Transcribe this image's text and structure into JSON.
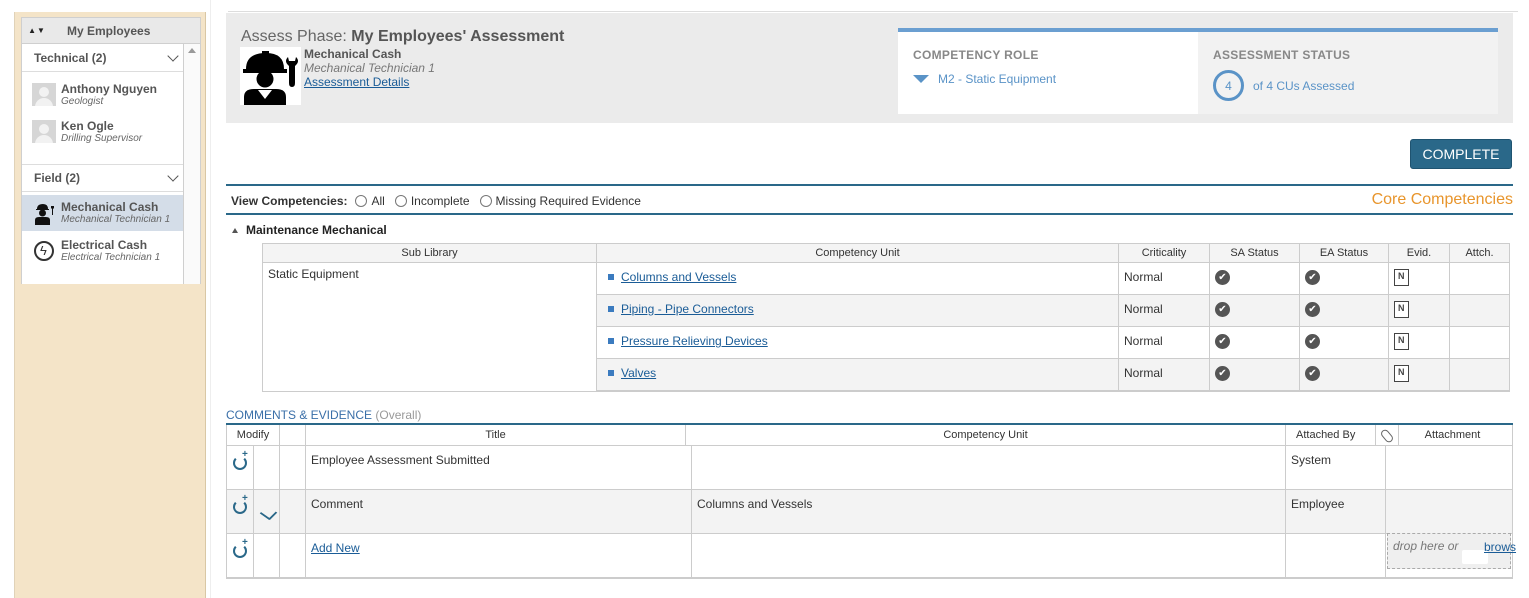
{
  "sidebar": {
    "title": "My Employees",
    "sort_glyph": "▲▼",
    "groups": [
      {
        "label": "Technical (2)",
        "employees": [
          {
            "name": "Anthony Nguyen",
            "role": "Geologist"
          },
          {
            "name": "Ken Ogle",
            "role": "Drilling Supervisor"
          }
        ]
      },
      {
        "label": "Field (2)",
        "employees": [
          {
            "name": "Mechanical Cash",
            "role": "Mechanical Technician 1",
            "selected": true
          },
          {
            "name": "Electrical Cash",
            "role": "Electrical Technician 1"
          }
        ]
      }
    ]
  },
  "header": {
    "phase_prefix": "Assess Phase:",
    "phase_title": "My Employees' Assessment",
    "employee_name": "Mechanical Cash",
    "employee_role": "Mechanical Technician 1",
    "details_link": "Assessment Details",
    "competency_role_label": "COMPETENCY ROLE",
    "competency_role_value": "M2 - Static Equipment",
    "assessment_status_label": "ASSESSMENT STATUS",
    "assessed_count": "4",
    "assessed_text": "of 4 CUs Assessed"
  },
  "complete_button": "COMPLETE",
  "view": {
    "label": "View Competencies:",
    "options": [
      "All",
      "Incomplete",
      "Missing Required Evidence"
    ]
  },
  "core_competencies": "Core Competencies",
  "library": "Maintenance Mechanical",
  "competency_table": {
    "headers": [
      "Sub Library",
      "Competency Unit",
      "Criticality",
      "SA Status",
      "EA Status",
      "Evid.",
      "Attch."
    ],
    "sub_library": "Static Equipment",
    "rows": [
      {
        "unit": "Columns and Vessels",
        "criticality": "Normal"
      },
      {
        "unit": "Piping - Pipe Connectors",
        "criticality": "Normal"
      },
      {
        "unit": "Pressure Relieving Devices",
        "criticality": "Normal"
      },
      {
        "unit": "Valves",
        "criticality": "Normal"
      }
    ]
  },
  "comments": {
    "title": "COMMENTS & EVIDENCE",
    "title_suffix": "(Overall)",
    "headers": [
      "Modify",
      "Title",
      "Competency Unit",
      "Attached By",
      "Attachment"
    ],
    "rows": [
      {
        "title": "Employee Assessment Submitted",
        "unit": "",
        "attached_by": "System"
      },
      {
        "title": "Comment",
        "unit": "Columns and Vessels",
        "attached_by": "Employee"
      }
    ],
    "add_new": "Add New",
    "drop_text": "drop here or",
    "browse_text": "brows"
  },
  "colors": {
    "accent": "#2a6889",
    "link": "#1a5c97",
    "status_blue": "#5a93c7",
    "core_orange": "#e8952c",
    "sidebar_bg": "#f4e4c8"
  }
}
